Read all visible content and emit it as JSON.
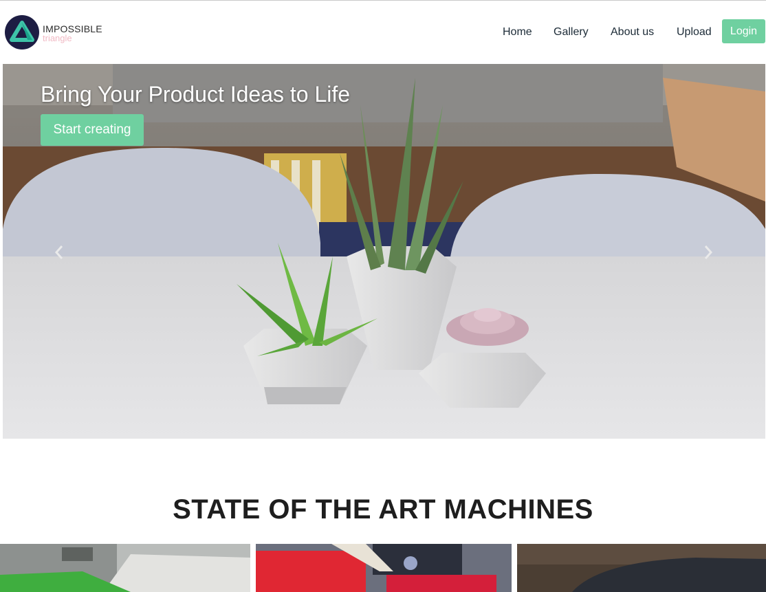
{
  "brand": {
    "name_line1": "IMPOSSIBLE",
    "name_line2": "triangle",
    "logo_icon": "impossible-triangle-icon"
  },
  "nav": {
    "items": [
      {
        "label": "Home"
      },
      {
        "label": "Gallery"
      },
      {
        "label": "About us"
      },
      {
        "label": "Upload"
      }
    ],
    "login_label": "Login"
  },
  "hero": {
    "title": "Bring Your Product Ideas to Life",
    "cta_label": "Start creating",
    "prev_icon": "chevron-left-icon",
    "next_icon": "chevron-right-icon"
  },
  "section": {
    "title": "STATE OF THE ART MACHINES"
  },
  "colors": {
    "accent": "#6fd0a0",
    "logo_bg": "#1d1d43",
    "brand_sub": "#f1b9c4"
  }
}
